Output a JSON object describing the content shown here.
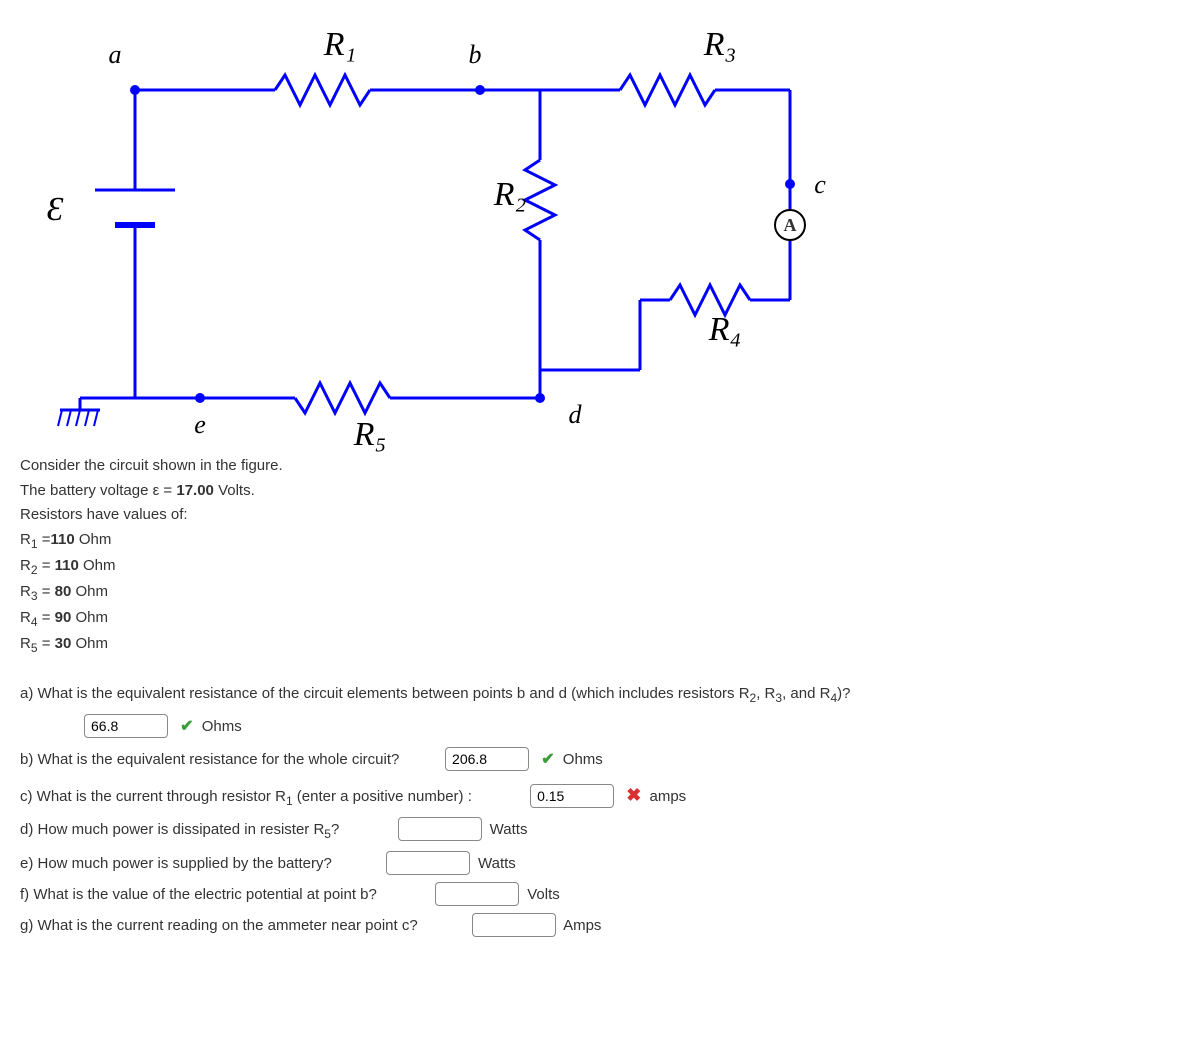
{
  "circuit": {
    "labels": {
      "a": "a",
      "b": "b",
      "c": "c",
      "d": "d",
      "e": "e",
      "E": "Ɛ",
      "R1": "R₁",
      "R2": "R₂",
      "R3": "R₃",
      "R4": "R₄",
      "R5": "R₅",
      "ammeter": "A"
    }
  },
  "problem": {
    "intro": "Consider the circuit shown in the figure.",
    "voltage_line_prefix": "The battery voltage ε = ",
    "voltage_value": "17.00",
    "voltage_line_suffix": " Volts.",
    "resistors_intro": "Resistors have values of:",
    "R1_line": "R₁ =110 Ohm",
    "R2_line": "R₂ = 110 Ohm",
    "R3_line": "R₃ = 80 Ohm",
    "R4_line": "R₄ = 90 Ohm",
    "R5_line": "R₅ = 30 Ohm"
  },
  "questions": {
    "a": {
      "text": "a) What is the equivalent resistance of the circuit elements between points b and d (which includes resistors R₂, R₃, and R₄)?",
      "value": "66.8",
      "unit": "Ohms",
      "status": "correct"
    },
    "b": {
      "text": "b) What is the equivalent resistance for the whole circuit?",
      "value": "206.8",
      "unit": "Ohms",
      "status": "correct"
    },
    "c": {
      "text": "c) What is the current through resistor R₁ (enter a positive number) :",
      "value": "0.15",
      "unit": "amps",
      "status": "incorrect"
    },
    "d": {
      "text": "d) How much power is dissipated in resister R₅?",
      "value": "",
      "unit": "Watts"
    },
    "e": {
      "text": "e) How much power is supplied by the battery?",
      "value": "",
      "unit": "Watts"
    },
    "f": {
      "text": "f) What is the value of the electric potential at point b?",
      "value": "",
      "unit": "Volts"
    },
    "g": {
      "text": "g) What is the current reading on the ammeter near point c?",
      "value": "",
      "unit": "Amps"
    }
  }
}
